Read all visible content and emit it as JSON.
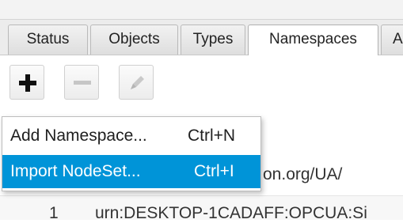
{
  "tabs": [
    {
      "label": "Status"
    },
    {
      "label": "Objects"
    },
    {
      "label": "Types"
    },
    {
      "label": "Namespaces"
    },
    {
      "label": "A"
    }
  ],
  "active_tab": "Namespaces",
  "toolbar": {
    "add_icon": "plus-icon",
    "remove_icon": "minus-icon",
    "edit_icon": "pencil-icon"
  },
  "menu": {
    "items": [
      {
        "label": "Add Namespace...",
        "shortcut": "Ctrl+N"
      },
      {
        "label": "Import NodeSet...",
        "shortcut": "Ctrl+I"
      }
    ],
    "highlight_color": "#0094d8"
  },
  "list": {
    "rows": [
      {
        "text": "on.org/UA/"
      },
      {
        "index": "1",
        "text": "urn:DESKTOP-1CADAFF:OPCUA:Si"
      }
    ]
  }
}
